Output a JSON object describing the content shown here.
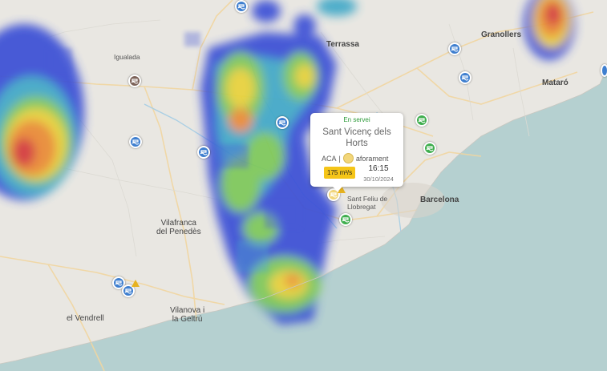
{
  "popup": {
    "status": "En servei",
    "station_line1": "Sant Vicenç dels",
    "station_line2": "Horts",
    "source": "ACA",
    "separator": "|",
    "gauge_label": "aforament",
    "flow": "175 m³/s",
    "time": "16:15",
    "date": "30/10/2024"
  },
  "places": {
    "barcelona": "Barcelona",
    "terrassa": "Terrassa",
    "granollers": "Granollers",
    "mataro": "Mataró",
    "igualada": "Igualada",
    "vilafranca_1": "Vilafranca",
    "vilafranca_2": "del Penedès",
    "vilanova_1": "Vilanova i",
    "vilanova_2": "la Geltrú",
    "vendrell": "el Vendrell",
    "sant_feliu_1": "Sant Feliu de",
    "sant_feliu_2": "Llobregat"
  },
  "colors": {
    "sea": "#b5d0d0",
    "land": "#e9e7e2",
    "river": "#a9cfe4",
    "road": "#f3d9a0",
    "radar_blue": "#3b4fd6",
    "radar_green": "#7dc85a",
    "radar_yellow": "#e8d23a",
    "radar_orange": "#ea8a34",
    "radar_red": "#d4383a",
    "station_blue": "#3f7fcf",
    "station_green": "#3fae4e",
    "flow_badge": "#f5c518"
  },
  "icons": {
    "station_marker": "water-gauge-icon",
    "warning": "warning-triangle-icon"
  }
}
